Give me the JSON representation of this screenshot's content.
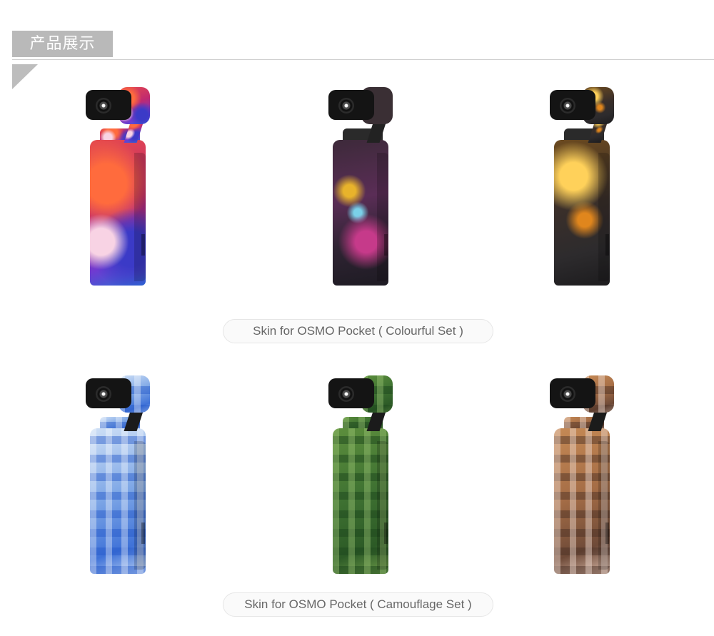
{
  "section": {
    "title": "产品展示"
  },
  "sets": [
    {
      "caption": "Skin for OSMO Pocket ( Colourful Set )",
      "products": [
        {
          "skin": "colourful-red-purple",
          "colors": [
            "#e74b4b",
            "#c02970",
            "#6f3bd1"
          ]
        },
        {
          "skin": "colourful-galaxy",
          "colors": [
            "#3d2a3a",
            "#c63a8a",
            "#e8b32b"
          ]
        },
        {
          "skin": "colourful-gold-flame",
          "colors": [
            "#ffd15a",
            "#e0861d",
            "#2d2b2d"
          ]
        }
      ]
    },
    {
      "caption": "Skin for OSMO Pocket ( Camouflage Set )",
      "products": [
        {
          "skin": "camouflage-blue",
          "colors": [
            "#cfe0f6",
            "#7ea7e6",
            "#3f72d8"
          ]
        },
        {
          "skin": "camouflage-green",
          "colors": [
            "#5d8f3d",
            "#3f7232",
            "#2c5a26"
          ]
        },
        {
          "skin": "camouflage-brown",
          "colors": [
            "#c68a55",
            "#a56d46",
            "#6e4a38"
          ]
        }
      ]
    }
  ],
  "colors": {
    "tab_background": "#b9b9b9",
    "divider": "#cfcfcf",
    "caption_text": "#666666"
  }
}
